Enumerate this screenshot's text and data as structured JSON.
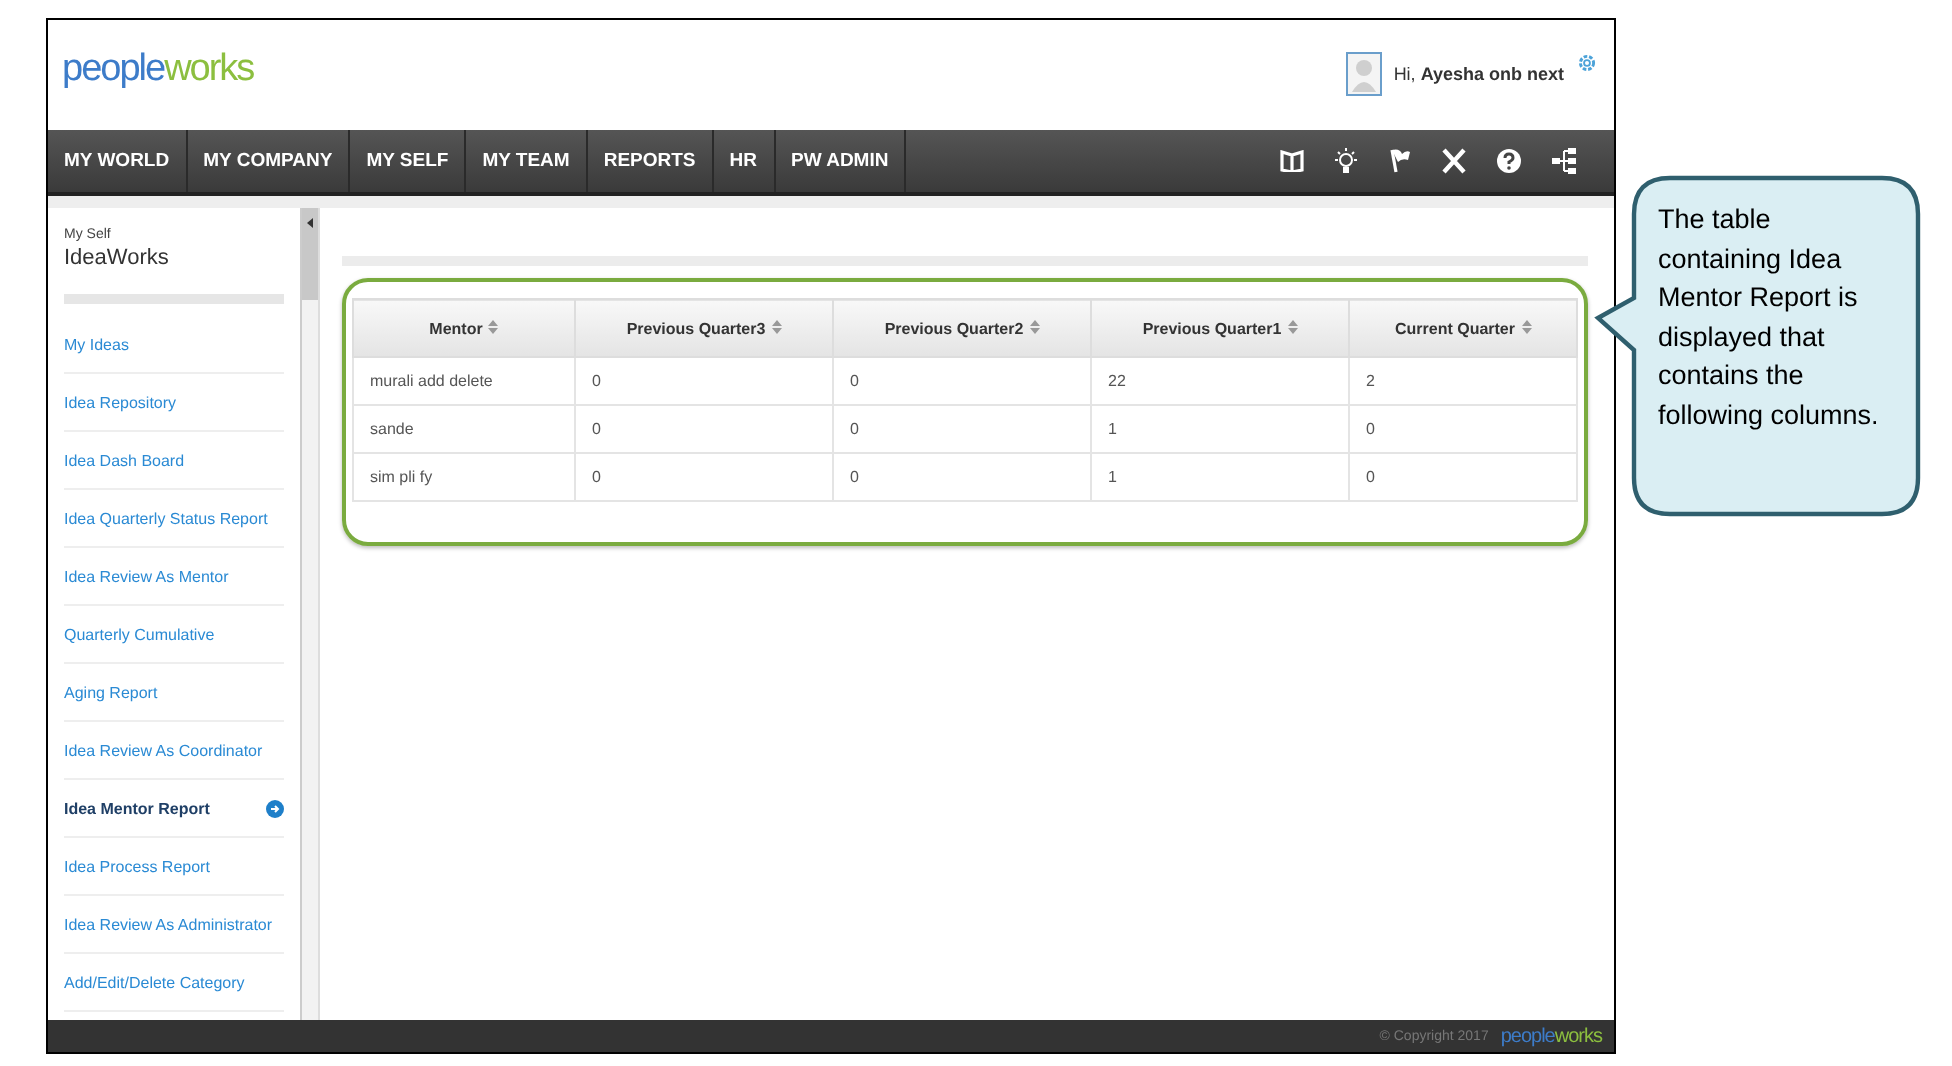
{
  "header": {
    "logo": {
      "part_1": "people",
      "part_2": "works"
    },
    "greeting": "Hi, **Ayesha onb next**"
  },
  "nav": {
    "items": [
      "MY WORLD",
      "MY COMPANY",
      "MY SELF",
      "MY TEAM",
      "REPORTS",
      "HR",
      "PW ADMIN"
    ]
  },
  "sidebar": {
    "section": "My Self",
    "title": "IdeaWorks",
    "items": [
      {
        "label": "My Ideas",
        "selected": false
      },
      {
        "label": "Idea Repository",
        "selected": false
      },
      {
        "label": "Idea Dash Board",
        "selected": false
      },
      {
        "label": "Idea Quarterly Status Report",
        "selected": false
      },
      {
        "label": "Idea Review As Mentor",
        "selected": false
      },
      {
        "label": "Quarterly Cumulative",
        "selected": false
      },
      {
        "label": "Aging Report",
        "selected": false
      },
      {
        "label": "Idea Review As Coordinator",
        "selected": false
      },
      {
        "label": "Idea Mentor Report",
        "selected": true
      },
      {
        "label": "Idea Process Report",
        "selected": false
      },
      {
        "label": "Idea Review As Administrator",
        "selected": false
      },
      {
        "label": "Add/Edit/Delete Category",
        "selected": false
      }
    ]
  },
  "table": {
    "columns": [
      "Mentor",
      "Previous Quarter3",
      "Previous Quarter2",
      "Previous Quarter1",
      "Current Quarter"
    ],
    "rows": [
      [
        "murali add delete",
        "0",
        "0",
        "22",
        "2"
      ],
      [
        "sande",
        "0",
        "0",
        "1",
        "0"
      ],
      [
        "sim pli fy",
        "0",
        "0",
        "1",
        "0"
      ]
    ]
  },
  "footer": {
    "copyright": "© Copyright 2017",
    "logo": {
      "part_1": "people",
      "part_2": "works"
    }
  },
  "callout": {
    "text": "The table containing Idea Mentor Report is displayed that contains the following columns."
  }
}
